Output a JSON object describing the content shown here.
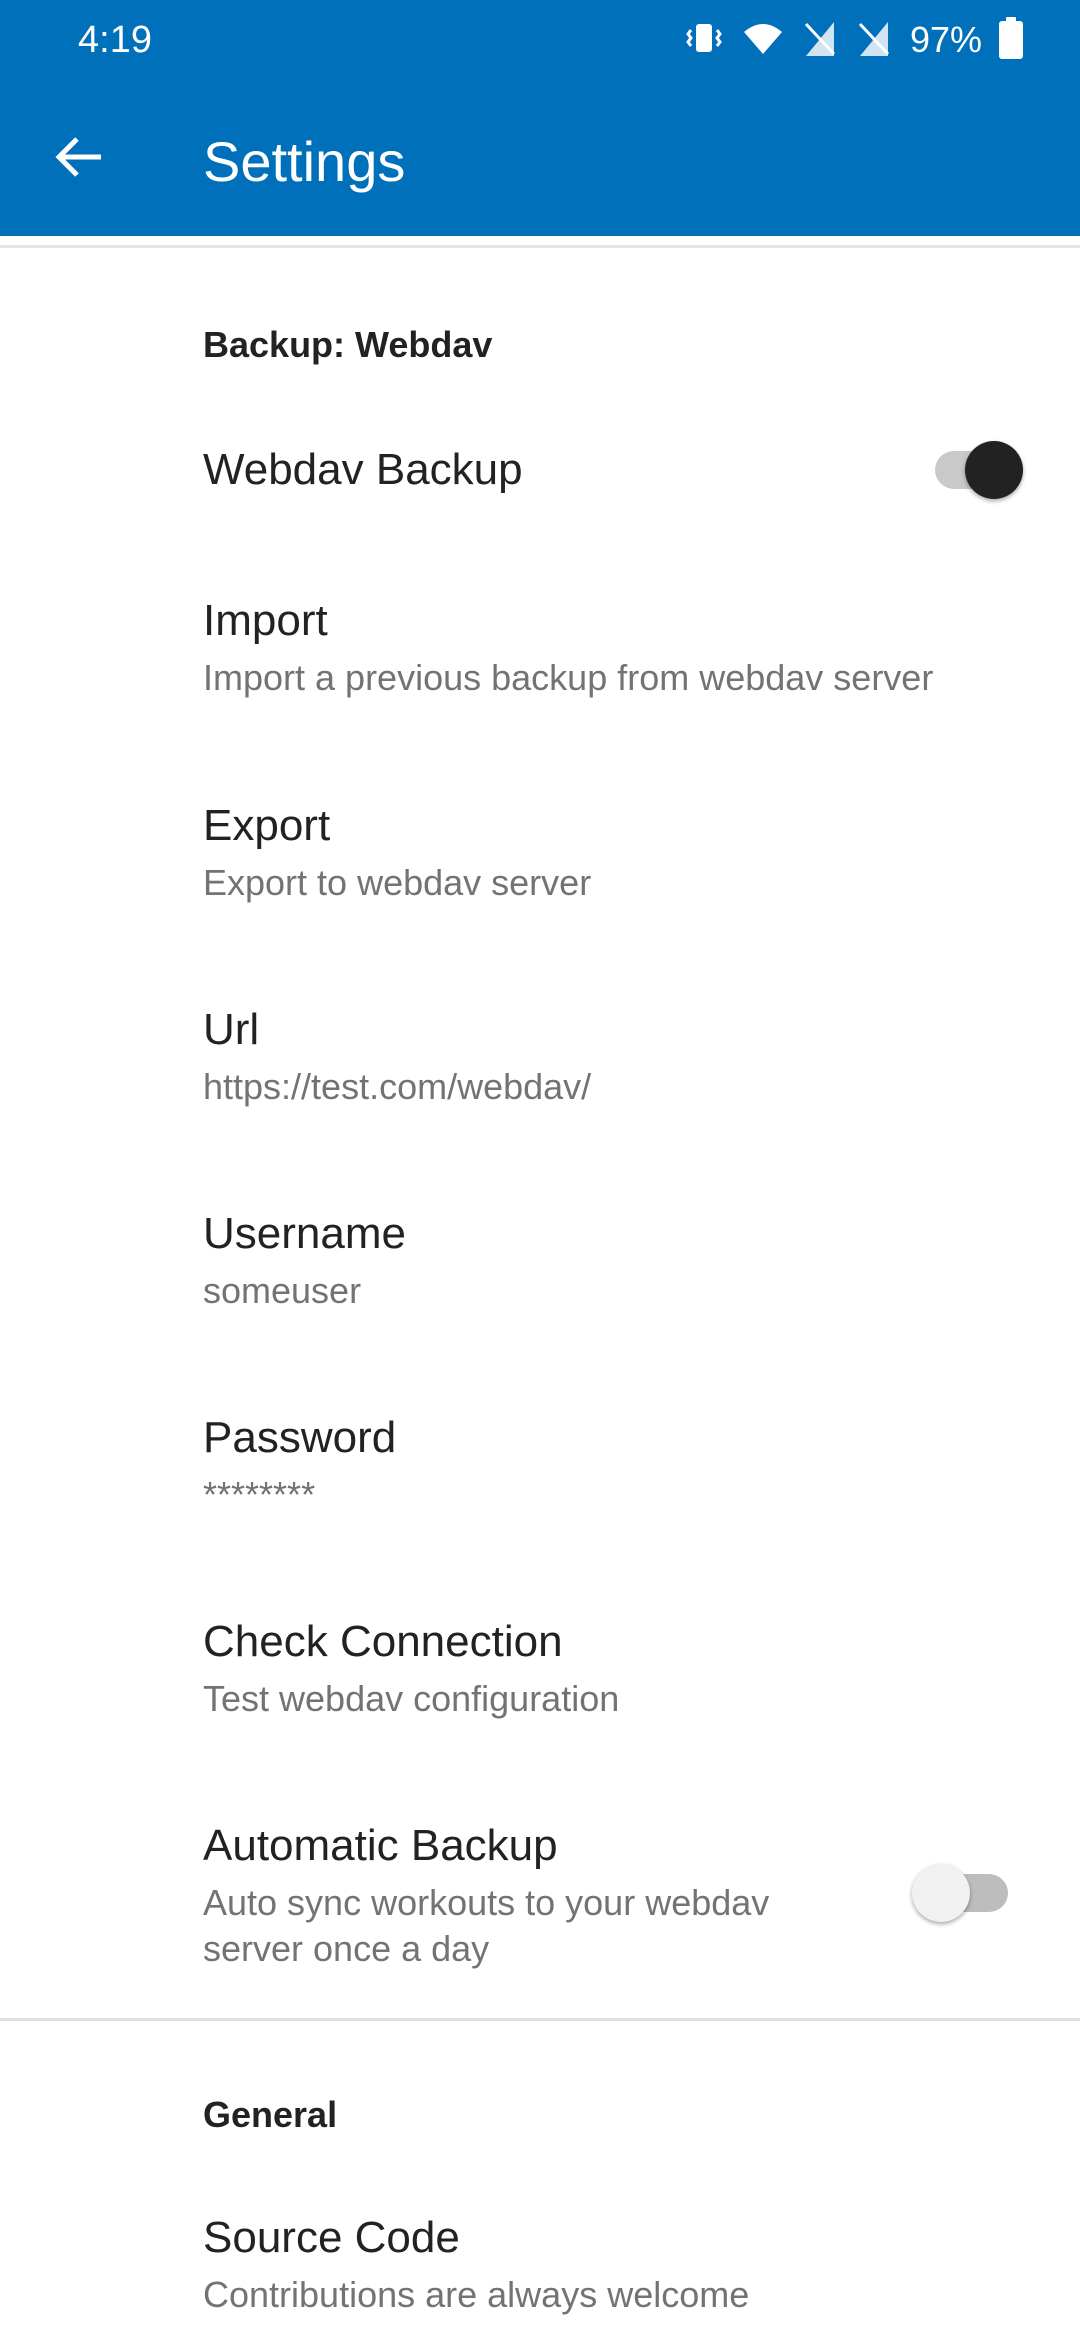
{
  "status_bar": {
    "time": "4:19",
    "battery_percent": "97%",
    "icons": [
      "vibrate-icon",
      "wifi-icon",
      "no-sim-icon",
      "no-sim-icon",
      "battery-icon"
    ]
  },
  "app_bar": {
    "title": "Settings",
    "back_icon": "arrow-back-icon",
    "color": "#0070bb"
  },
  "sections": [
    {
      "header": "Backup: Webdav",
      "items": [
        {
          "title": "Webdav Backup",
          "summary": "",
          "switch": "on"
        },
        {
          "title": "Import",
          "summary": "Import a previous backup from webdav server"
        },
        {
          "title": "Export",
          "summary": "Export to webdav server"
        },
        {
          "title": "Url",
          "summary": "https://test.com/webdav/"
        },
        {
          "title": "Username",
          "summary": "someuser"
        },
        {
          "title": "Password",
          "summary": "********"
        },
        {
          "title": "Check Connection",
          "summary": "Test webdav configuration"
        },
        {
          "title": "Automatic Backup",
          "summary": "Auto sync workouts to your webdav server once a day",
          "switch": "off"
        }
      ]
    },
    {
      "header": "General",
      "items": [
        {
          "title": "Source Code",
          "summary": "Contributions are always welcome"
        }
      ]
    }
  ]
}
